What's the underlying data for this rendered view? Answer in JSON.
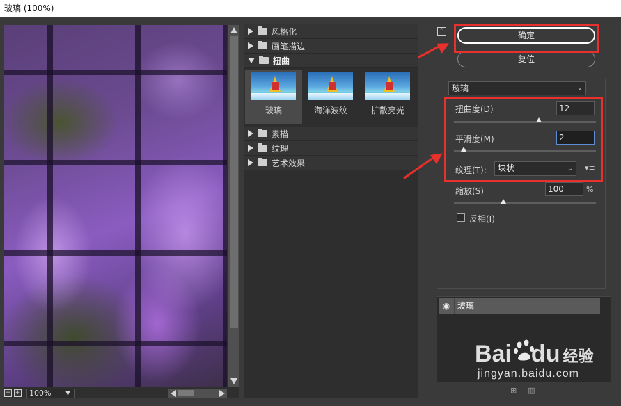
{
  "window": {
    "title": "玻璃 (100%)"
  },
  "preview": {
    "zoom": "100%",
    "zoom_out": "−",
    "zoom_in": "+"
  },
  "gallery": {
    "categories_top": [
      {
        "label": "风格化",
        "open": false
      },
      {
        "label": "画笔描边",
        "open": false
      }
    ],
    "open_category": {
      "label": "扭曲"
    },
    "thumbnails": [
      {
        "label": "玻璃",
        "selected": true
      },
      {
        "label": "海洋波纹",
        "selected": false
      },
      {
        "label": "扩散亮光",
        "selected": false
      }
    ],
    "categories_bottom": [
      {
        "label": "素描"
      },
      {
        "label": "纹理"
      },
      {
        "label": "艺术效果"
      }
    ]
  },
  "actions": {
    "ok_label": "确定",
    "reset_label": "复位",
    "collapse_icon": "⌃"
  },
  "settings": {
    "filter_name": "玻璃",
    "distortion": {
      "label": "扭曲度(D)",
      "value": "12",
      "level": 0.6
    },
    "smoothness": {
      "label": "平滑度(M)",
      "value": "2",
      "level": 0.07
    },
    "texture": {
      "label": "纹理(T):",
      "value": "块状",
      "menu_icon": "▾≡"
    },
    "scale": {
      "label": "缩放(S)",
      "value": "100",
      "unit": "%",
      "level": 0.35
    },
    "invert": {
      "label": "反相(I)",
      "checked": false
    }
  },
  "layers": {
    "items": [
      {
        "name": "玻璃",
        "visible": true
      }
    ]
  },
  "watermark": {
    "brand": "Bai",
    "brand2": "du",
    "cn": "经验",
    "url": "jingyan.baidu.com"
  },
  "colors": {
    "annotation_red": "#e8302c",
    "panel_bg": "#3a3a3a"
  }
}
